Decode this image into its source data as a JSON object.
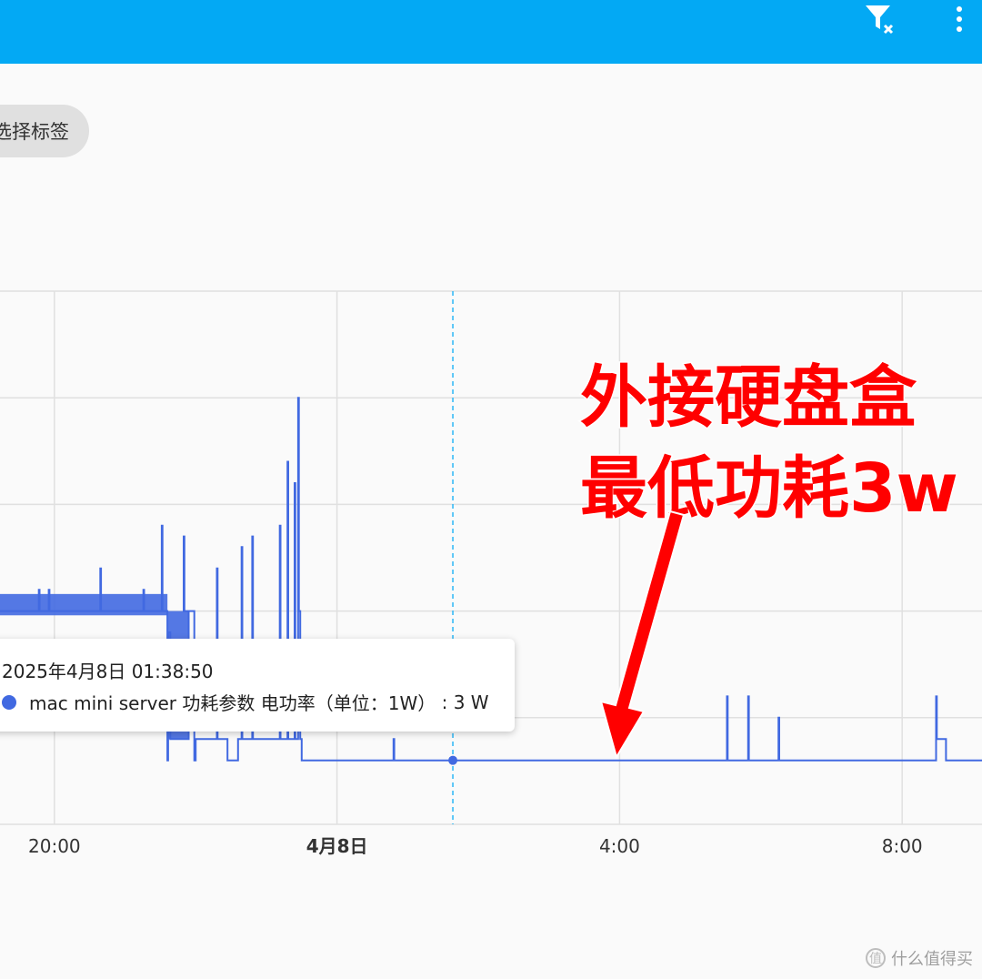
{
  "toolbar": {
    "filter_icon": "filter-clear-icon",
    "more_icon": "more-vert-icon",
    "accent": "#03a9f4"
  },
  "filter_chip": {
    "label": "选择标签"
  },
  "tooltip": {
    "timestamp": "2025年4月8日 01:38:50",
    "series_label": "mac mini server 功耗参数 电功率（单位：1W）",
    "value_text": "3 W",
    "dot_color": "#4169e1"
  },
  "annotation": {
    "line1": "外接硬盘盒",
    "line2": "最低功耗3w",
    "color": "#ff0000"
  },
  "watermark": {
    "logo": "值",
    "text": "什么值得买"
  },
  "chart_data": {
    "type": "line",
    "line_color": "#4169e1",
    "grid": true,
    "x_unit": "hours since 2025-04-07 00:00",
    "x_ticks": [
      {
        "x": 20,
        "label": "20:00",
        "bold": false
      },
      {
        "x": 24,
        "label": "4月8日",
        "bold": true
      },
      {
        "x": 28,
        "label": "4:00",
        "bold": false
      },
      {
        "x": 32,
        "label": "8:00",
        "bold": false
      }
    ],
    "xlim": [
      19.23,
      33.13
    ],
    "ylim": [
      0,
      25
    ],
    "y_grid": [
      0,
      5,
      10,
      15,
      20,
      25
    ],
    "cursor_x": 25.64,
    "cursor_y": 3,
    "series": [
      {
        "name": "mac mini server 功耗参数 电功率（单位：1W）",
        "points": [
          [
            19.23,
            10
          ],
          [
            19.78,
            10
          ],
          [
            19.78,
            11
          ],
          [
            19.79,
            11
          ],
          [
            19.79,
            10
          ],
          [
            19.92,
            10
          ],
          [
            19.92,
            11
          ],
          [
            19.93,
            11
          ],
          [
            19.93,
            10
          ],
          [
            20.65,
            10
          ],
          [
            20.65,
            12
          ],
          [
            20.66,
            12
          ],
          [
            20.66,
            10
          ],
          [
            21.26,
            10
          ],
          [
            21.26,
            11
          ],
          [
            21.27,
            11
          ],
          [
            21.27,
            10
          ],
          [
            21.52,
            10
          ],
          [
            21.52,
            14
          ],
          [
            21.53,
            14
          ],
          [
            21.53,
            10
          ],
          [
            21.6,
            10
          ],
          [
            21.6,
            3
          ],
          [
            21.61,
            3
          ],
          [
            21.61,
            9
          ],
          [
            21.64,
            9
          ],
          [
            21.64,
            4
          ],
          [
            21.9,
            4
          ],
          [
            21.9,
            10
          ],
          [
            21.83,
            10
          ],
          [
            21.83,
            13.5
          ],
          [
            21.84,
            13.5
          ],
          [
            21.84,
            10
          ],
          [
            21.98,
            10
          ],
          [
            21.98,
            3
          ],
          [
            22.0,
            3
          ],
          [
            22.0,
            4
          ],
          [
            22.3,
            4
          ],
          [
            22.3,
            12
          ],
          [
            22.31,
            12
          ],
          [
            22.31,
            4
          ],
          [
            22.45,
            4
          ],
          [
            22.45,
            3
          ],
          [
            22.6,
            3
          ],
          [
            22.6,
            4
          ],
          [
            22.65,
            4
          ],
          [
            22.65,
            13
          ],
          [
            22.66,
            13
          ],
          [
            22.66,
            4
          ],
          [
            22.8,
            4
          ],
          [
            22.8,
            13.5
          ],
          [
            22.81,
            13.5
          ],
          [
            22.81,
            4
          ],
          [
            23.19,
            4
          ],
          [
            23.19,
            14
          ],
          [
            23.2,
            14
          ],
          [
            23.2,
            4
          ],
          [
            23.3,
            4
          ],
          [
            23.3,
            17
          ],
          [
            23.31,
            17
          ],
          [
            23.31,
            4
          ],
          [
            23.4,
            4
          ],
          [
            23.4,
            16
          ],
          [
            23.41,
            16
          ],
          [
            23.41,
            4
          ],
          [
            23.45,
            4
          ],
          [
            23.45,
            20
          ],
          [
            23.46,
            20
          ],
          [
            23.46,
            10
          ],
          [
            23.48,
            10
          ],
          [
            23.48,
            4
          ],
          [
            23.5,
            4
          ],
          [
            23.5,
            3
          ],
          [
            24.8,
            3
          ],
          [
            24.8,
            4
          ],
          [
            24.81,
            4
          ],
          [
            24.81,
            3
          ],
          [
            25.64,
            3
          ],
          [
            29.52,
            3
          ],
          [
            29.52,
            6
          ],
          [
            29.53,
            6
          ],
          [
            29.53,
            3
          ],
          [
            29.82,
            3
          ],
          [
            29.82,
            6
          ],
          [
            29.83,
            6
          ],
          [
            29.83,
            3
          ],
          [
            30.25,
            3
          ],
          [
            30.25,
            5
          ],
          [
            30.26,
            5
          ],
          [
            30.26,
            3
          ],
          [
            32.48,
            3
          ],
          [
            32.48,
            6
          ],
          [
            32.49,
            6
          ],
          [
            32.49,
            4
          ],
          [
            32.62,
            4
          ],
          [
            32.62,
            3
          ],
          [
            33.13,
            3
          ]
        ],
        "dense_bands": [
          {
            "x_start": 19.23,
            "x_end": 21.6,
            "y_low": 9.8,
            "y_high": 10.8
          },
          {
            "x_start": 21.6,
            "x_end": 21.9,
            "y_low": 4,
            "y_high": 10
          }
        ]
      }
    ]
  }
}
